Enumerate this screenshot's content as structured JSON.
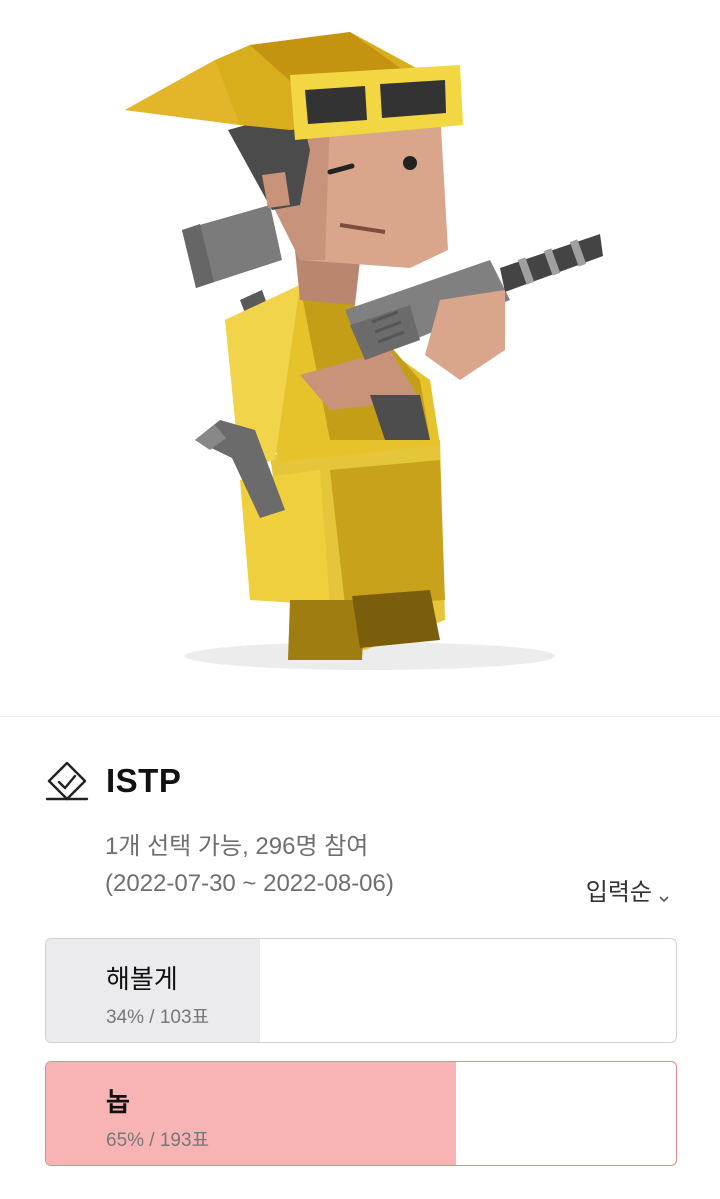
{
  "poll": {
    "title": "ISTP",
    "meta_line1": "1개 선택 가능, 296명 참여",
    "meta_line2": "(2022-07-30 ~ 2022-08-06)",
    "sort_label": "입력순",
    "options": [
      {
        "label": "해볼게",
        "stats": "34% / 103표",
        "percent": 34,
        "fill_color": "#ebebed",
        "selected": false
      },
      {
        "label": "놉",
        "stats": "65% / 193표",
        "percent": 65,
        "fill_color": "#f8b4b5",
        "selected": true
      }
    ]
  },
  "colors": {
    "selected_fill": "#f8b4b5",
    "unselected_fill": "#ebebed",
    "border": "#d2d2d2"
  },
  "icons": {
    "poll": "ballot-check-icon",
    "sort": "chevron-down-icon"
  }
}
